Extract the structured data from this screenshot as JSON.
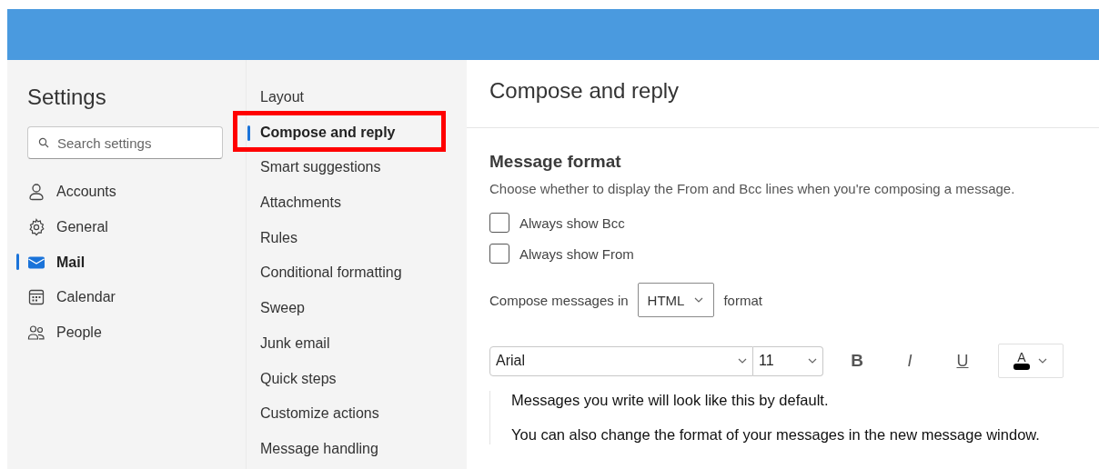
{
  "settings_nav": {
    "title": "Settings",
    "search": {
      "placeholder": "Search settings"
    },
    "items": [
      {
        "label": "Accounts",
        "kind": "person",
        "selected": false
      },
      {
        "label": "General",
        "kind": "gear",
        "selected": false
      },
      {
        "label": "Mail",
        "kind": "mail",
        "selected": true
      },
      {
        "label": "Calendar",
        "kind": "calendar",
        "selected": false
      },
      {
        "label": "People",
        "kind": "people",
        "selected": false
      }
    ]
  },
  "categories": [
    {
      "label": "Layout",
      "selected": false,
      "highlighted": false
    },
    {
      "label": "Compose and reply",
      "selected": true,
      "highlighted": true
    },
    {
      "label": "Smart suggestions",
      "selected": false,
      "highlighted": false
    },
    {
      "label": "Attachments",
      "selected": false,
      "highlighted": false
    },
    {
      "label": "Rules",
      "selected": false,
      "highlighted": false
    },
    {
      "label": "Conditional formatting",
      "selected": false,
      "highlighted": false
    },
    {
      "label": "Sweep",
      "selected": false,
      "highlighted": false
    },
    {
      "label": "Junk email",
      "selected": false,
      "highlighted": false
    },
    {
      "label": "Quick steps",
      "selected": false,
      "highlighted": false
    },
    {
      "label": "Customize actions",
      "selected": false,
      "highlighted": false
    },
    {
      "label": "Message handling",
      "selected": false,
      "highlighted": false
    }
  ],
  "content": {
    "title": "Compose and reply",
    "section": "Message format",
    "description": "Choose whether to display the From and Bcc lines when you're composing a message.",
    "checkboxes": [
      {
        "label": "Always show Bcc",
        "checked": false
      },
      {
        "label": "Always show From",
        "checked": false
      }
    ],
    "compose_format": {
      "before": "Compose messages in",
      "value": "HTML",
      "after": "format"
    },
    "toolbar": {
      "font": "Arial",
      "size": "11",
      "buttons": [
        {
          "kind": "bold",
          "label": "B"
        },
        {
          "kind": "italic",
          "label": "I"
        },
        {
          "kind": "underline",
          "label": "U"
        }
      ],
      "font_color": {
        "label": "A"
      }
    },
    "preview": [
      "Messages you write will look like this by default.",
      "You can also change the format of your messages in the new message window."
    ]
  }
}
